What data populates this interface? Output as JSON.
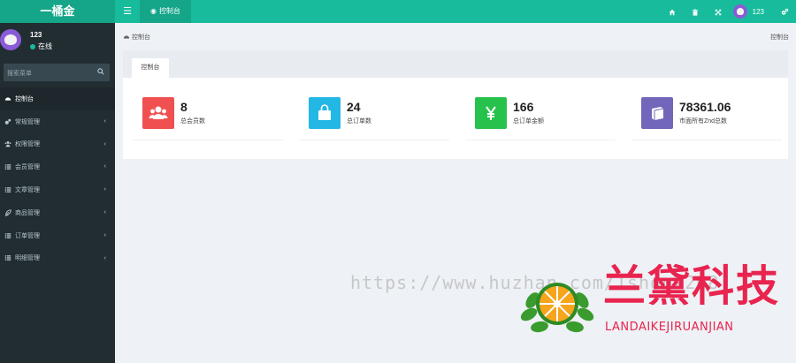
{
  "app": {
    "title": "一桶金"
  },
  "topbar": {
    "tab_label": "控制台",
    "user_name": "123",
    "accent_color": "#18bc9c"
  },
  "sidebar": {
    "user_name": "123",
    "status": "在线",
    "search_placeholder": "搜索菜单",
    "items": [
      {
        "label": "控制台",
        "icon": "dashboard-icon",
        "active": true
      },
      {
        "label": "常规管理",
        "icon": "cogs-icon"
      },
      {
        "label": "权限管理",
        "icon": "group-icon"
      },
      {
        "label": "会员管理",
        "icon": "list-icon"
      },
      {
        "label": "文章管理",
        "icon": "list-icon"
      },
      {
        "label": "商品管理",
        "icon": "leaf-icon"
      },
      {
        "label": "订单管理",
        "icon": "list-icon"
      },
      {
        "label": "明细管理",
        "icon": "list-icon"
      }
    ]
  },
  "breadcrumb": {
    "label": "控制台",
    "right": "控制台"
  },
  "panel": {
    "tab_label": "控制台"
  },
  "stats": [
    {
      "value": "8",
      "label": "总会员数",
      "color": "#f05050",
      "icon": "users-icon"
    },
    {
      "value": "24",
      "label": "总订单数",
      "color": "#23b7e5",
      "icon": "shopping-bag-icon"
    },
    {
      "value": "166",
      "label": "总订单金额",
      "color": "#27c24c",
      "icon": "yen-icon"
    },
    {
      "value": "78361.06",
      "label": "市面所有Znd总数",
      "color": "#7266ba",
      "icon": "book-icon"
    }
  ],
  "watermark": {
    "url": "https://www.huzhan.com/1shop2208",
    "brand": "兰黛科技",
    "pinyin": "LANDAIKEJIRUANJIAN"
  }
}
